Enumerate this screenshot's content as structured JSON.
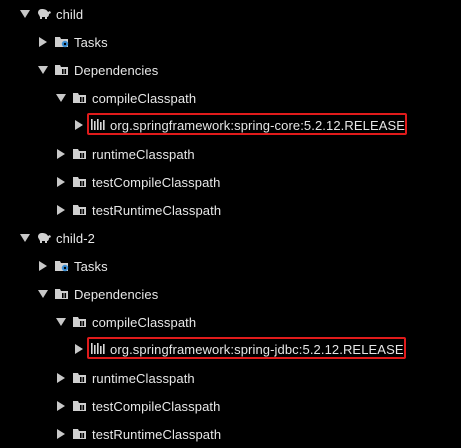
{
  "accent": {
    "highlight_border": "#e01b1b",
    "text": "#e8e8e8",
    "icon_gray": "#bfbfbf",
    "gradle_blue": "#3a8fd6"
  },
  "projects": [
    {
      "name": "child",
      "icon": "elephant-icon",
      "tasks_label": "Tasks",
      "dependencies_label": "Dependencies",
      "configurations": [
        {
          "name": "compileClasspath",
          "dependency": "org.springframework:spring-core:5.2.12.RELEASE",
          "highlighted": true
        },
        {
          "name": "runtimeClasspath"
        },
        {
          "name": "testCompileClasspath"
        },
        {
          "name": "testRuntimeClasspath"
        }
      ]
    },
    {
      "name": "child-2",
      "icon": "elephant-icon",
      "tasks_label": "Tasks",
      "dependencies_label": "Dependencies",
      "configurations": [
        {
          "name": "compileClasspath",
          "dependency": "org.springframework:spring-jdbc:5.2.12.RELEASE",
          "highlighted": true
        },
        {
          "name": "runtimeClasspath"
        },
        {
          "name": "testCompileClasspath"
        },
        {
          "name": "testRuntimeClasspath"
        }
      ]
    }
  ]
}
